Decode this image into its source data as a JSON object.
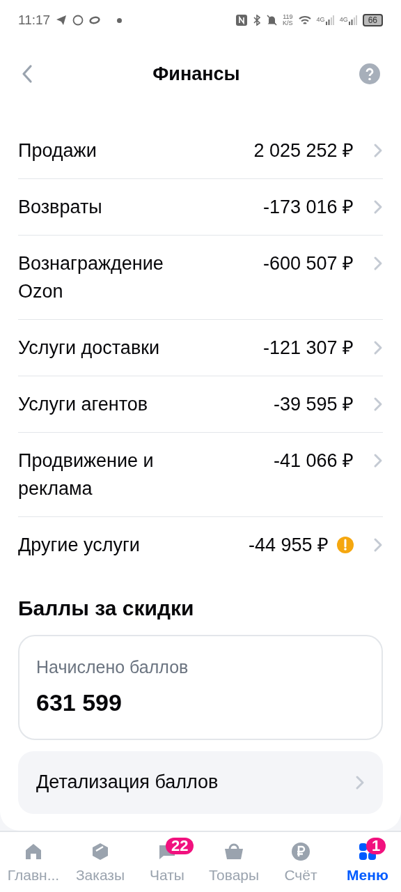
{
  "status_bar": {
    "time": "11:17",
    "speed": "119",
    "speed_unit": "K/S",
    "network_1": "4G",
    "network_2": "4G",
    "battery": "66"
  },
  "header": {
    "title": "Финансы"
  },
  "rows": [
    {
      "label": "Продажи",
      "value": "2 025 252 ₽",
      "warning": false
    },
    {
      "label": "Возвраты",
      "value": "-173 016 ₽",
      "warning": false
    },
    {
      "label": "Вознаграждение Ozon",
      "value": "-600 507 ₽",
      "warning": false
    },
    {
      "label": "Услуги доставки",
      "value": "-121 307 ₽",
      "warning": false
    },
    {
      "label": "Услуги агентов",
      "value": "-39 595 ₽",
      "warning": false
    },
    {
      "label": "Продвижение и реклама",
      "value": "-41 066 ₽",
      "warning": false
    },
    {
      "label": "Другие услуги",
      "value": "-44 955 ₽",
      "warning": true
    }
  ],
  "points": {
    "title": "Баллы за скидки",
    "card_label": "Начислено баллов",
    "card_value": "631 599",
    "details_link": "Детализация баллов"
  },
  "tab_bar": [
    {
      "kind": "home",
      "label": "Главн...",
      "selected": false
    },
    {
      "kind": "orders",
      "label": "Заказы",
      "selected": false
    },
    {
      "kind": "chats",
      "label": "Чаты",
      "selected": false,
      "badge": "22"
    },
    {
      "kind": "goods",
      "label": "Товары",
      "selected": false
    },
    {
      "kind": "account",
      "label": "Счёт",
      "selected": false
    },
    {
      "kind": "menu",
      "label": "Меню",
      "selected": true,
      "badge": "1"
    }
  ]
}
